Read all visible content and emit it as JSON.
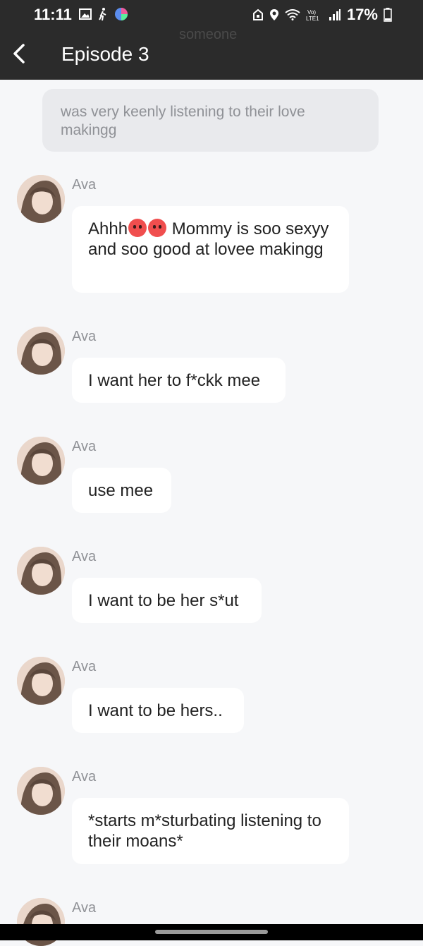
{
  "status": {
    "time": "11:11",
    "battery": "17%",
    "left_icons": [
      "image-icon",
      "walking-icon",
      "color-app-icon"
    ],
    "right_icons": [
      "lock-home-icon",
      "location-icon",
      "wifi-icon",
      "volte-icon",
      "signal-icon",
      "battery-icon"
    ]
  },
  "header": {
    "faded_text": "someone",
    "title": "Episode 3"
  },
  "narration": "was very keenly listening to their love makingg",
  "messages": [
    {
      "sender": "Ava",
      "text_before": "Ahhh",
      "text_after": " Mommy is soo sexyy and soo good at lovee makingg"
    },
    {
      "sender": "Ava",
      "text": "I want her to f*ckk mee"
    },
    {
      "sender": "Ava",
      "text": "use mee"
    },
    {
      "sender": "Ava",
      "text": "I want to be her s*ut"
    },
    {
      "sender": "Ava",
      "text": "I want to be hers.."
    },
    {
      "sender": "Ava",
      "text": "*starts m*sturbating listening to their moans*"
    },
    {
      "sender": "Ava"
    }
  ],
  "colors": {
    "header_bg": "#2b2b2b",
    "page_bg": "#f6f7f9",
    "bubble_bg": "#ffffff",
    "narration_bg": "#e9eaed"
  }
}
